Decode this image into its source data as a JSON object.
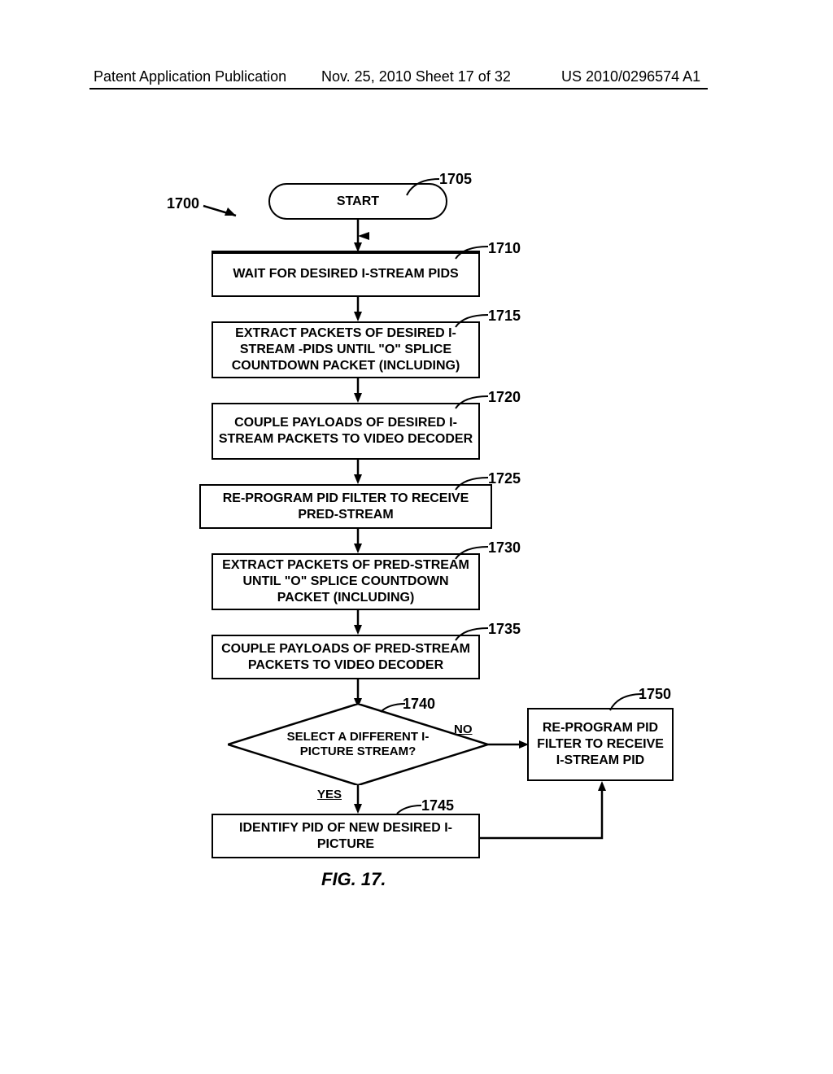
{
  "header": {
    "left": "Patent Application Publication",
    "center": "Nov. 25, 2010  Sheet 17 of 32",
    "right": "US 2010/0296574 A1"
  },
  "flow": {
    "ref_main": "1700",
    "start": "START",
    "n1705": "1705",
    "step1710": "WAIT FOR DESIRED I-STREAM PIDS",
    "n1710": "1710",
    "step1715": "EXTRACT PACKETS OF DESIRED I-STREAM -PIDS UNTIL \"O\" SPLICE COUNTDOWN PACKET (INCLUDING)",
    "n1715": "1715",
    "step1720": "COUPLE PAYLOADS OF DESIRED I-STREAM PACKETS TO VIDEO DECODER",
    "n1720": "1720",
    "step1725": "RE-PROGRAM PID FILTER TO RECEIVE PRED-STREAM",
    "n1725": "1725",
    "step1730": "EXTRACT PACKETS OF PRED-STREAM UNTIL \"O\" SPLICE COUNTDOWN PACKET (INCLUDING)",
    "n1730": "1730",
    "step1735": "COUPLE PAYLOADS OF PRED-STREAM PACKETS TO VIDEO DECODER",
    "n1735": "1735",
    "decision1740": "SELECT A DIFFERENT I-PICTURE STREAM?",
    "n1740": "1740",
    "yes": "YES",
    "no": "NO",
    "step1745": "IDENTIFY PID OF NEW DESIRED I-PICTURE",
    "n1745": "1745",
    "step1750": "RE-PROGRAM PID FILTER TO RECEIVE I-STREAM PID",
    "n1750": "1750"
  },
  "caption": "FIG.  17."
}
